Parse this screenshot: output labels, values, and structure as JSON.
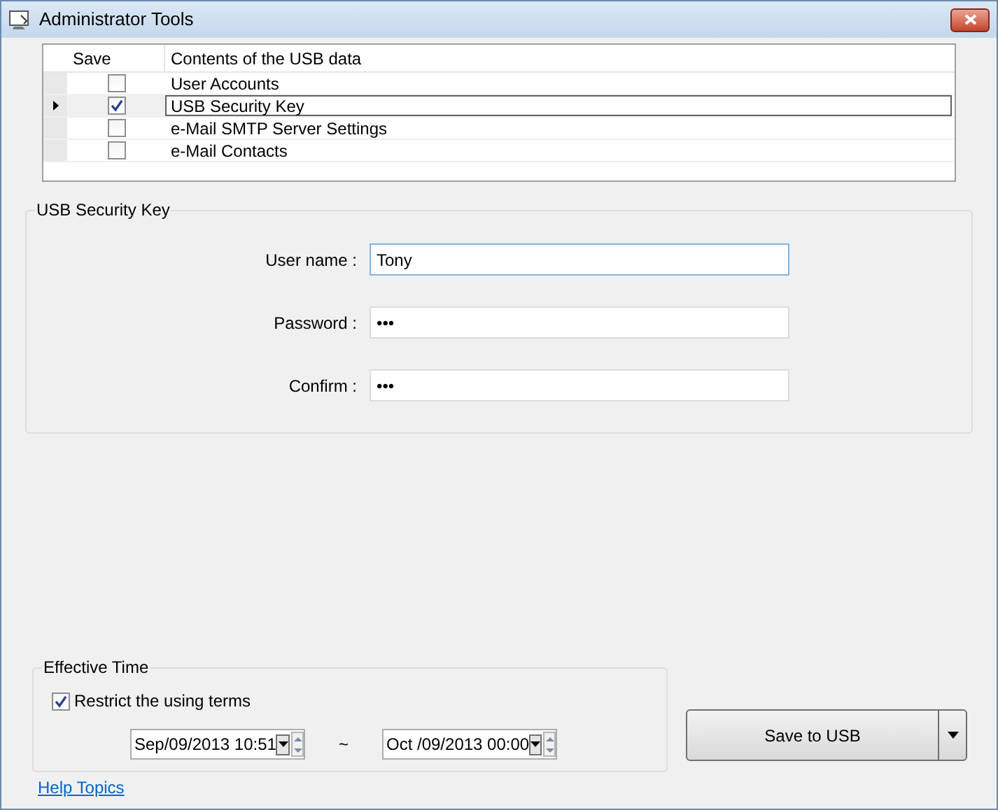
{
  "window": {
    "title": "Administrator Tools"
  },
  "grid": {
    "columns": [
      "Save",
      "Contents of the USB data"
    ],
    "rows": [
      {
        "label": "User Accounts",
        "checked": false,
        "selected": false
      },
      {
        "label": "USB Security Key",
        "checked": true,
        "selected": true
      },
      {
        "label": "e-Mail SMTP Server Settings",
        "checked": false,
        "selected": false
      },
      {
        "label": "e-Mail Contacts",
        "checked": false,
        "selected": false
      }
    ]
  },
  "security_key": {
    "title": "USB Security Key",
    "fields": [
      {
        "label": "User name :",
        "value": "Tony"
      },
      {
        "label": "Password :",
        "value": "•••"
      },
      {
        "label": "Confirm :",
        "value": "•••"
      }
    ]
  },
  "effective_time": {
    "title": "Effective Time",
    "restrict": {
      "label": "Restrict the using terms",
      "checked": true
    },
    "from": "Sep/09/2013 10:51",
    "separator": "~",
    "to": "Oct /09/2013 00:00"
  },
  "save_button": "Save to USB",
  "help_link": "Help Topics"
}
